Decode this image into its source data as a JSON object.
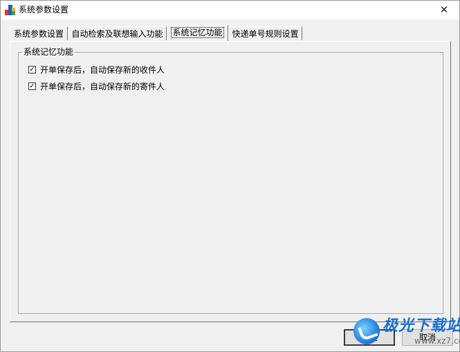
{
  "window": {
    "title": "系统参数设置",
    "close_glyph": "✕"
  },
  "tabs": [
    {
      "label": "系统参数设置",
      "active": false
    },
    {
      "label": "自动检索及联想输入功能",
      "active": false
    },
    {
      "label": "系统记忆功能",
      "active": true
    },
    {
      "label": "快递单号规则设置",
      "active": false
    }
  ],
  "group": {
    "title": "系统记忆功能",
    "options": [
      {
        "label": "开单保存后，自动保存新的收件人",
        "checked": true
      },
      {
        "label": "开单保存后，自动保存新的寄件人",
        "checked": true
      }
    ]
  },
  "buttons": {
    "ok": "确定",
    "cancel": "取消"
  },
  "watermark": {
    "name": "极光下载站",
    "url": "www.xz7.com"
  },
  "check_glyph": "✓"
}
